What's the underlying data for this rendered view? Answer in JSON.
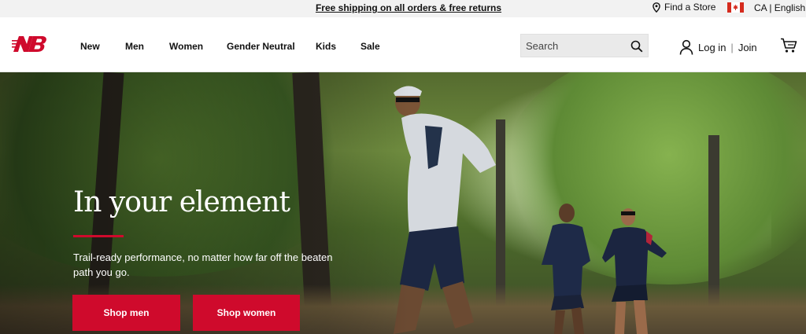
{
  "topbar": {
    "promo": "Free shipping on all orders & free returns",
    "find_store": "Find a Store",
    "locale": "CA | English",
    "icons": {
      "store": "map-pin-icon",
      "flag": "canada-flag-icon"
    }
  },
  "header": {
    "logo": "new-balance-logo",
    "nav": [
      "New",
      "Men",
      "Women",
      "Gender Neutral",
      "Kids",
      "Sale"
    ],
    "search_placeholder": "Search",
    "login": "Log in",
    "join": "Join",
    "icons": {
      "search": "search-icon",
      "user": "user-icon",
      "cart": "cart-icon"
    }
  },
  "hero": {
    "title": "In your element",
    "subtitle": "Trail-ready performance, no matter how far off the beaten path you go.",
    "buttons": {
      "men": "Shop men",
      "women": "Shop women"
    }
  },
  "colors": {
    "accent": "#cf0a2c",
    "topbar_bg": "#f2f2f2",
    "search_bg": "#eaeaea"
  }
}
